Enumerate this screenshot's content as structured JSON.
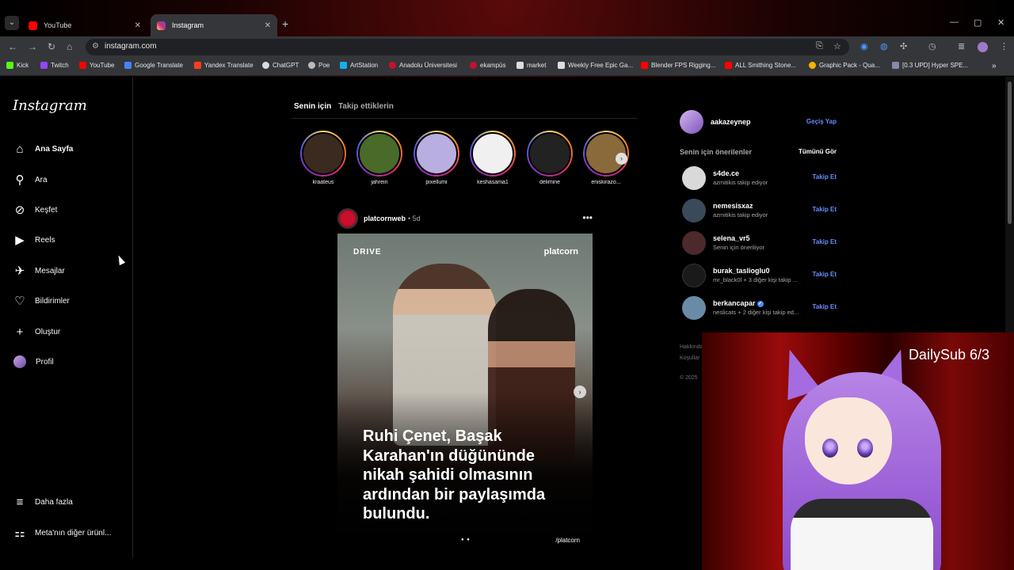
{
  "browser": {
    "tabs": [
      {
        "title": "YouTube",
        "color": "#ff0000",
        "active": false
      },
      {
        "title": "Instagram",
        "color": "#d62976",
        "active": true
      }
    ],
    "url": "instagram.com",
    "bookmarks": [
      {
        "label": "Kick",
        "color": "#53fc18"
      },
      {
        "label": "Twitch",
        "color": "#9146ff"
      },
      {
        "label": "YouTube",
        "color": "#ff0000"
      },
      {
        "label": "Google Translate",
        "color": "#4285f4"
      },
      {
        "label": "Yandex Translate",
        "color": "#fc3f1d"
      },
      {
        "label": "ChatGPT",
        "color": "#dddddd"
      },
      {
        "label": "Poe",
        "color": "#bbbbbb"
      },
      {
        "label": "ArtStation",
        "color": "#13aff0"
      },
      {
        "label": "Anadolu Üniversitesi",
        "color": "#c8102e"
      },
      {
        "label": "ekampüs",
        "color": "#c8102e"
      },
      {
        "label": "market",
        "color": "#dddddd"
      },
      {
        "label": "Weekly Free Epic Ga...",
        "color": "#dddddd"
      },
      {
        "label": "Blender FPS Rigging...",
        "color": "#ff0000"
      },
      {
        "label": "ALL Smithing Stone...",
        "color": "#ff0000"
      },
      {
        "label": "Graphic Pack - Qua...",
        "color": "#f4b400"
      },
      {
        "label": "[0.3 UPD] Hyper SPE...",
        "color": "#8888aa"
      }
    ]
  },
  "instagram": {
    "logo": "Instagram",
    "nav": [
      {
        "label": "Ana Sayfa",
        "icon": "⌂",
        "icon_name": "home-icon"
      },
      {
        "label": "Ara",
        "icon": "⚲",
        "icon_name": "search-icon"
      },
      {
        "label": "Keşfet",
        "icon": "⊘",
        "icon_name": "compass-icon"
      },
      {
        "label": "Reels",
        "icon": "▶",
        "icon_name": "reels-icon"
      },
      {
        "label": "Mesajlar",
        "icon": "✈",
        "icon_name": "messages-icon"
      },
      {
        "label": "Bildirimler",
        "icon": "♡",
        "icon_name": "heart-icon"
      },
      {
        "label": "Oluştur",
        "icon": "+",
        "icon_name": "create-icon"
      },
      {
        "label": "Profil",
        "icon": "",
        "icon_name": "avatar"
      }
    ],
    "more": {
      "label": "Daha fazla",
      "icon": "≡"
    },
    "meta": {
      "label": "Meta'nın diğer ürünl...",
      "icon": "⚏"
    },
    "feed_tabs": {
      "for_you": "Senin için",
      "following": "Takip ettiklerin"
    },
    "stories": [
      {
        "name": "kraateus",
        "bg": "#3a2a20"
      },
      {
        "name": "jahrein",
        "bg": "#4a6a2a"
      },
      {
        "name": "pixellumi",
        "bg": "#b8aee0"
      },
      {
        "name": "keshasama1",
        "bg": "#f0f0f0"
      },
      {
        "name": "delimine",
        "bg": "#222222"
      },
      {
        "name": "eniskirazo...",
        "bg": "#8a6a3a"
      }
    ],
    "post": {
      "author": "platcornweb",
      "time": "• 5d",
      "brand_left": "DRIVE",
      "brand_right": "platcorn",
      "caption": "Ruhi Çenet, Başak Karahan'ın düğününde nikah şahidi olmasının ardından bir paylaşımda bulundu.",
      "credit": "/platcorn",
      "dots": "● ●"
    },
    "me": {
      "username": "aakazeynep",
      "switch": "Geçiş Yap"
    },
    "suggestions_title": "Senin için önerilenler",
    "see_all": "Tümünü Gör",
    "suggestions": [
      {
        "username": "s4de.ce",
        "sub": "azmitikis takip ediyor",
        "follow": "Takip Et",
        "bg": "#d9d9d9",
        "verified": false
      },
      {
        "username": "nemesisxaz",
        "sub": "azmitikis takip ediyor",
        "follow": "Takip Et",
        "bg": "#3a4a5a",
        "verified": false
      },
      {
        "username": "selena_vr5",
        "sub": "Senin için öneriliyor",
        "follow": "Takip Et",
        "bg": "#4a2a2a",
        "verified": false
      },
      {
        "username": "burak_taslioglu0",
        "sub": "mr_black0l + 3 diğer kişi takip ...",
        "follow": "Takip Et",
        "bg": "#1a1a1a",
        "verified": false
      },
      {
        "username": "berkancapar",
        "sub": "neslicats + 2 diğer kişi takip ed...",
        "follow": "Takip Et",
        "bg": "#6a8aa8",
        "verified": true
      }
    ],
    "footer": [
      "Hakkında",
      "Koşullar",
      "© 2025"
    ]
  },
  "overlay": {
    "label": "DailySub 6/3"
  }
}
